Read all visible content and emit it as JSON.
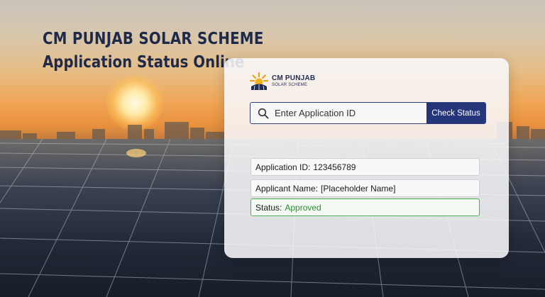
{
  "headline": {
    "line1": "CM PUNJAB SOLAR SCHEME",
    "line2": "Application Status Online"
  },
  "logo": {
    "line1": "CM PUNJAB",
    "line2": "SOLAR SCHEME"
  },
  "search": {
    "placeholder": "Enter Application ID",
    "button_label": "Check Status"
  },
  "result": {
    "application_id_label": "Application ID:",
    "application_id_value": "123456789",
    "applicant_name_label": "Applicant Name:",
    "applicant_name_value": "[Placeholder Name]",
    "status_label": "Status:",
    "status_value": "Approved"
  },
  "colors": {
    "brand": "#25357a",
    "headline": "#1f2a4a",
    "status_ok": "#2e8b35"
  }
}
